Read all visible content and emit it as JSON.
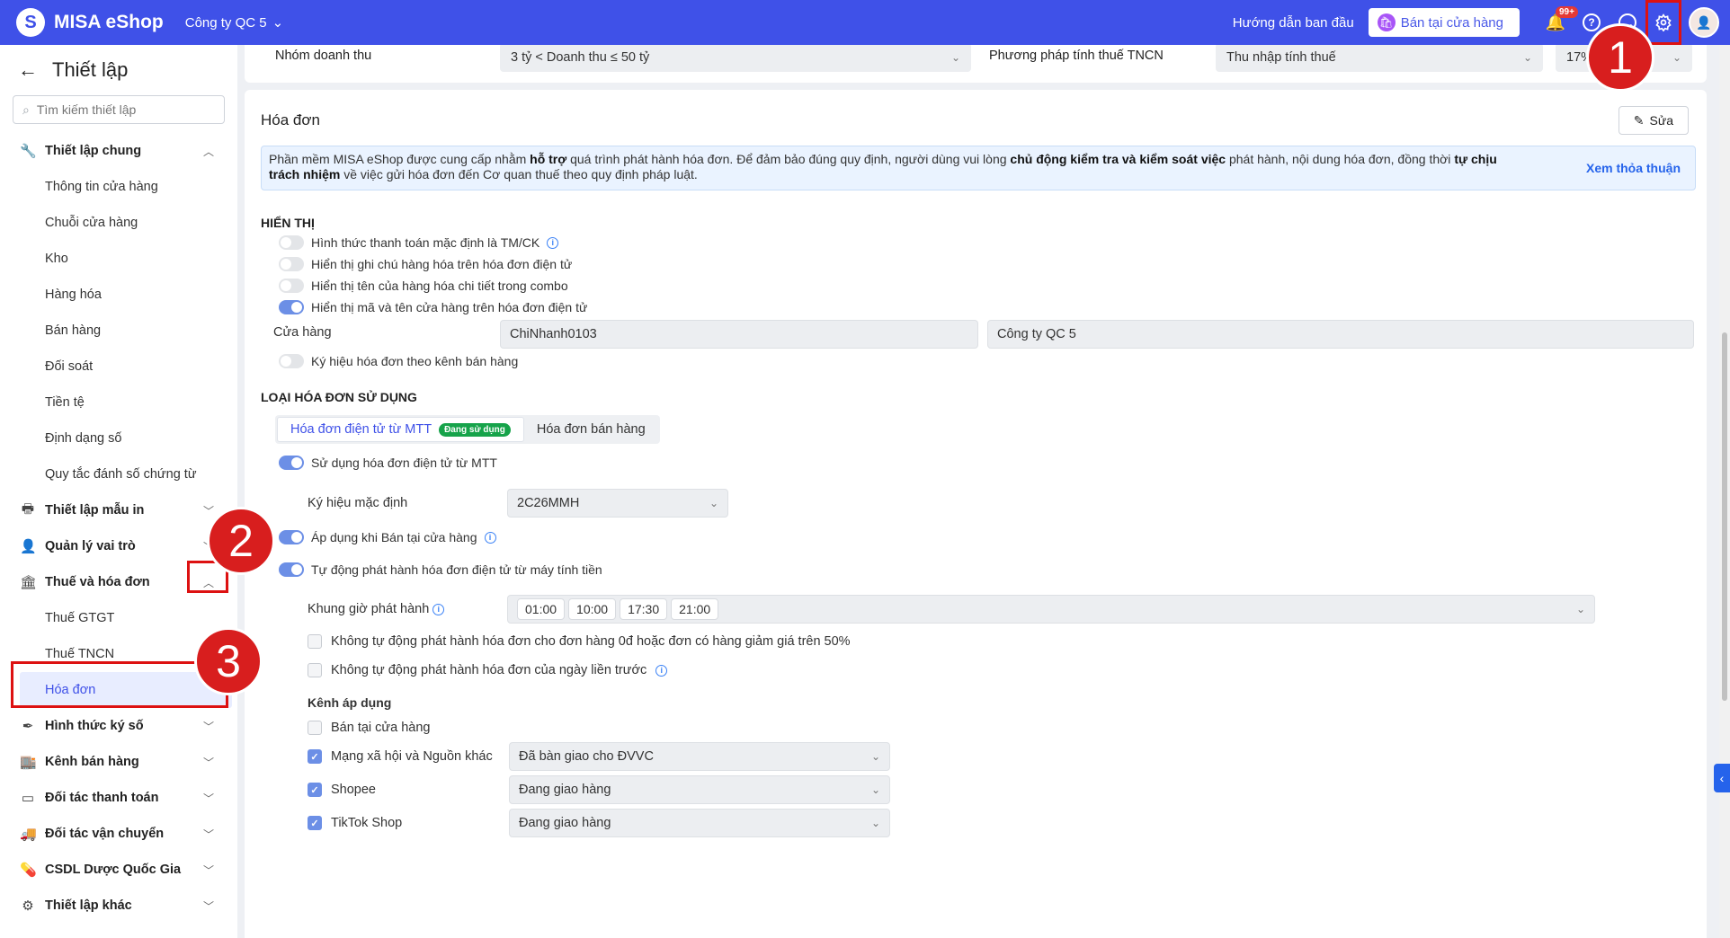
{
  "topbar": {
    "logo_letter": "S",
    "app_name": "MISA eShop",
    "company": "Công ty QC 5",
    "guide": "Hướng dẫn ban đầu",
    "sell_button": "Bán tại cửa hàng",
    "notification_count": "99+",
    "help_symbol": "?",
    "accent_color": "#3f51e8"
  },
  "sidebar": {
    "title": "Thiết lập",
    "search_placeholder": "Tìm kiếm thiết lập",
    "groups": [
      {
        "label": "Thiết lập chung",
        "icon": "wrench-icon",
        "expanded": true,
        "items": [
          "Thông tin cửa hàng",
          "Chuỗi cửa hàng",
          "Kho",
          "Hàng hóa",
          "Bán hàng",
          "Đối soát",
          "Tiền tệ",
          "Định dạng số",
          "Quy tắc đánh số chứng từ"
        ]
      },
      {
        "label": "Thiết lập mẫu in",
        "icon": "printer-icon"
      },
      {
        "label": "Quản lý vai trò",
        "icon": "user-role-icon"
      },
      {
        "label": "Thuế và hóa đơn",
        "icon": "building-icon",
        "expanded": true,
        "items": [
          "Thuế GTGT",
          "Thuế TNCN",
          "Hóa đơn"
        ],
        "active_item": "Hóa đơn"
      },
      {
        "label": "Hình thức ký số",
        "icon": "pen-icon"
      },
      {
        "label": "Kênh bán hàng",
        "icon": "store-icon"
      },
      {
        "label": "Đối tác thanh toán",
        "icon": "card-icon"
      },
      {
        "label": "Đối tác vận chuyển",
        "icon": "truck-icon"
      },
      {
        "label": "CSDL Dược Quốc Gia",
        "icon": "pill-icon"
      },
      {
        "label": "Thiết lập khác",
        "icon": "gear-icon"
      }
    ]
  },
  "callouts": [
    "1",
    "2",
    "3"
  ],
  "top_card": {
    "revenue_label": "Nhóm doanh thu",
    "revenue_value": "3 tỷ < Doanh thu ≤ 50 tỷ",
    "pit_method_label": "Phương pháp tính thuế TNCN",
    "pit_method_value": "Thu nhập tính thuế",
    "rate_value": "17%"
  },
  "invoice": {
    "title": "Hóa đơn",
    "edit": "Sửa",
    "notice_1": "Phần mềm MISA eShop được cung cấp nhằm ",
    "notice_b1": "hỗ trợ",
    "notice_2": " quá trình phát hành hóa đơn. Để đảm bảo đúng quy định, người dùng vui lòng ",
    "notice_b2": "chủ động kiểm tra và kiểm soát việc",
    "notice_3": " phát hành, nội dung hóa đơn, đồng thời ",
    "notice_b3": "tự chịu trách nhiệm",
    "notice_4": " về việc gửi hóa đơn đến Cơ quan thuế theo quy định pháp luật.",
    "notice_link": "Xem thỏa thuận",
    "display_title": "HIỂN THỊ",
    "display_toggles": [
      {
        "label": "Hình thức thanh toán mặc định là TM/CK",
        "on": false
      },
      {
        "label": "Hiển thị ghi chú hàng hóa trên hóa đơn điện tử",
        "on": false
      },
      {
        "label": "Hiển thị tên của hàng hóa chi tiết trong combo",
        "on": false
      },
      {
        "label": "Hiển thị mã và tên cửa hàng trên hóa đơn điện tử",
        "on": true
      }
    ],
    "store_label": "Cửa hàng",
    "store_code": "ChiNhanh0103",
    "store_name": "Công ty QC 5",
    "symbol_toggle": "Ký hiệu hóa đơn theo kênh bán hàng",
    "type_title": "LOẠI HÓA ĐƠN SỬ DỤNG",
    "tab_mtt": "Hóa đơn điện tử từ MTT",
    "tab_mtt_badge": "Đang sử dụng",
    "tab_sales": "Hóa đơn bán hàng",
    "use_mtt": "Sử dụng hóa đơn điện tử từ MTT",
    "default_symbol_label": "Ký hiệu mặc định",
    "default_symbol_value": "2C26MMH",
    "apply_store": "Áp dụng khi Bán tại cửa hàng",
    "auto_issue": "Tự động phát hành hóa đơn điện tử từ máy tính tiền",
    "time_label": "Khung giờ phát hành",
    "times": [
      "01:00",
      "10:00",
      "17:30",
      "21:00"
    ],
    "no_auto_zero": "Không tự động phát hành hóa đơn cho đơn hàng 0đ hoặc đơn có hàng giảm giá trên 50%",
    "no_auto_prev": "Không tự động phát hành hóa đơn của ngày liền trước",
    "channels_title": "Kênh áp dụng",
    "channels": [
      {
        "label": "Bán tại cửa hàng",
        "checked": false,
        "status": ""
      },
      {
        "label": "Mạng xã hội và Nguồn khác",
        "checked": true,
        "status": "Đã bàn giao cho ĐVVC"
      },
      {
        "label": "Shopee",
        "checked": true,
        "status": "Đang giao hàng"
      },
      {
        "label": "TikTok Shop",
        "checked": true,
        "status": "Đang giao hàng"
      }
    ]
  }
}
